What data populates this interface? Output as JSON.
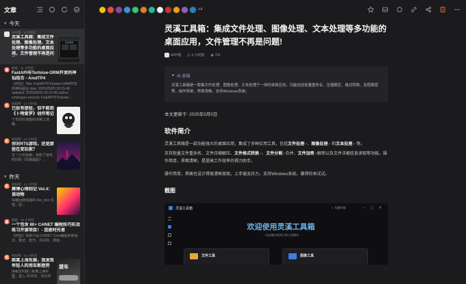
{
  "sidebar": {
    "title": "文章",
    "sections": [
      {
        "label": "今天",
        "items": [
          {
            "source": "APP喵 · 3 小时前",
            "title": "灵溪工具箱：集成文件处理、图像处理、文本处理等多功能的桌面应用，文件管理不再是问题！",
            "summary": "",
            "icon_color": "#e8e8e8",
            "active": true
          },
          {
            "source": "掘金 · 11 小时前",
            "title": "FastAPI与Tortoise-ORM开发的神仙组合 - AmdTP4",
            "summary": "【阿里】Title: FastAPI与Tortoise-ORM开发的神仙组合 date: 2025/05/05 00:15:48 updated: 2025/05/05 00:15:48 author: cmdragon excerpt: FastAPI与Tortoise-...",
            "icon_color": "#e04a3b",
            "active": false
          },
          {
            "source": "机核网 · 13 小时前",
            "title": "已投有那些，但不能到《卜特爱罗》创作笔记",
            "summary": "十年前在漫画的道路上迷路...",
            "icon_color": "#e8672b",
            "active": false
          },
          {
            "source": "机核网 · 13 小时前",
            "title": "你对RTS游戏，还是那些在变玩家？",
            "summary": "五一小长假期，我玩了很长时间的《风暴崛起》...",
            "icon_color": "#e8672b",
            "active": false
          }
        ]
      },
      {
        "label": "昨天",
        "items": [
          {
            "source": "机核网 · 14 小时前",
            "title": "赛博心得回记 Vol.4：谈动物",
            "summary": "车脑回转线插的 Itzo_Itzo 究竟，别...",
            "icon_color": "#e8672b",
            "active": false
          },
          {
            "source": "掘金 · 15 小时前",
            "title": "一个包含 80+ C#/NET 编程技巧实战练习开源项目！- 追逐时光者",
            "summary": "【阿里】项目介绍 C#/NET Core编程常用语法、算法、技巧、中间件、类库...",
            "icon_color": "#e04a3b",
            "active": false
          },
          {
            "source": "机核网 · 16 小时前",
            "title": "距离上海车展，我发现年轻人的用车新趋势",
            "summary": "探秘吉利展 | 距离上海车展，进入 2025年，百合欢展与日的...",
            "icon_color": "#e8672b",
            "active": false
          }
        ]
      }
    ]
  },
  "topbar": {
    "more_count": "+4",
    "avatar_colors": [
      "#f1c40f",
      "#e74c3c",
      "#8e44ad",
      "#3498db",
      "#2ecc71",
      "#e67e22",
      "#1abc9c",
      "#ecf0f1",
      "#c0392b",
      "#f39c12",
      "#9b59b6",
      "#2980b9"
    ]
  },
  "article": {
    "title": "灵溪工具箱：集成文件处理、图像处理、文本处理等多功能的桌面应用，文件管理不再是问题!",
    "author": "APP喵",
    "time": "3 小时前",
    "reads": "2:E",
    "ai_label": "AI 总结",
    "ai_summary": "灵溪工具箱是一款集文件处理、图像处理、文本处理于一体的桌面应用，功能包括批量重命名、压缩解压、格式转换、加密解密等，操作简单，界面清晰，支持Windows系统。",
    "date_line": "本文更新于: 2025年5月5日",
    "h2": "软件简介",
    "p1_a": "灵溪工具箱是一款功能强大的桌面应用，集成了多种实用工具，包括",
    "p1_b1": "文件处理",
    "p1_c": "、",
    "p1_b2": "图像处理",
    "p1_d": " 和",
    "p1_b3": "文本处理",
    "p1_e": " 等。",
    "p2_a": "支持批量文件重命名、文件压缩解压、",
    "p2_b1": "文件格式转换",
    "p2_c": "、",
    "p2_b2": "文件分割",
    "p2_d": "合并、",
    "p2_b3": "文件加密",
    "p2_e": "解密以及文件详细信息读取等功能。操作简单，界面清晰，是提高工作效率的得力助手。",
    "p3": "操作简单，界面也设计得很清晰美观，上手毫无压力，支持Windows系统。",
    "p3_b": "赛得你来试试。",
    "h3": "截图",
    "shot": {
      "app_name": "灵溪工具箱",
      "theme": "☾ 切换外观",
      "welcome": "欢迎使用灵溪工具箱",
      "sub": "一站式解决您的日常工具需求",
      "card1": "文件工具",
      "card2": "图像工具"
    }
  }
}
